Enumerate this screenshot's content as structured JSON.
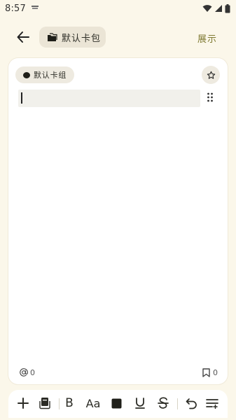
{
  "status_bar": {
    "time": "8:57"
  },
  "header": {
    "deck_label": "默认卡包",
    "show_label": "展示"
  },
  "card": {
    "group_label": "默认卡组",
    "field_value": "",
    "mention_count": "0",
    "bookmark_count": "0"
  },
  "toolbar": {
    "bold_label": "B",
    "font_size_label": "Aa"
  },
  "colors": {
    "background": "#fbf7ea",
    "card": "#ffffff",
    "chip": "#ebe5d6",
    "accent": "#7f7a32"
  }
}
